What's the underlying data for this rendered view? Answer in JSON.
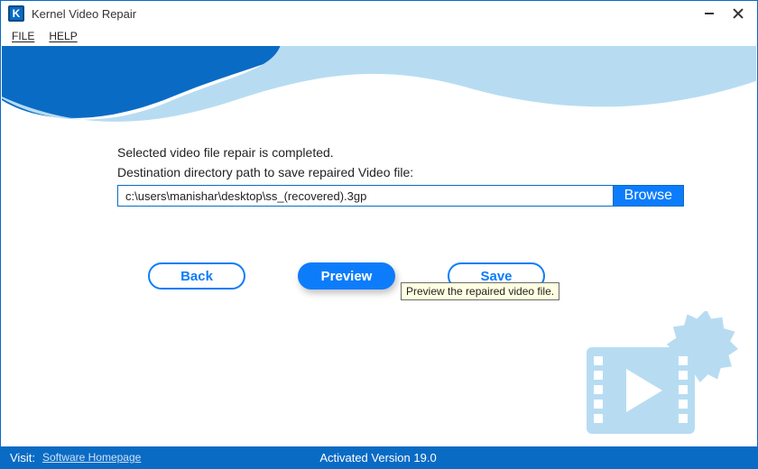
{
  "app": {
    "title": "Kernel Video Repair",
    "icon_letter": "K"
  },
  "menu": {
    "file": "FILE",
    "help": "HELP"
  },
  "main": {
    "line1": "Selected video file repair is completed.",
    "line2": "Destination directory path to save repaired Video file:",
    "path_value": "c:\\users\\manishar\\desktop\\ss_(recovered).3gp",
    "browse_label": "Browse",
    "back_label": "Back",
    "preview_label": "Preview",
    "save_label": "Save",
    "tooltip": "Preview the repaired video file."
  },
  "status": {
    "visit_label": "Visit:",
    "homepage_link": "Software Homepage",
    "version": "Activated Version 19.0"
  },
  "colors": {
    "brand": "#0a6bc4",
    "accent": "#0d7cfb",
    "wave_light": "#b7dcf2"
  }
}
